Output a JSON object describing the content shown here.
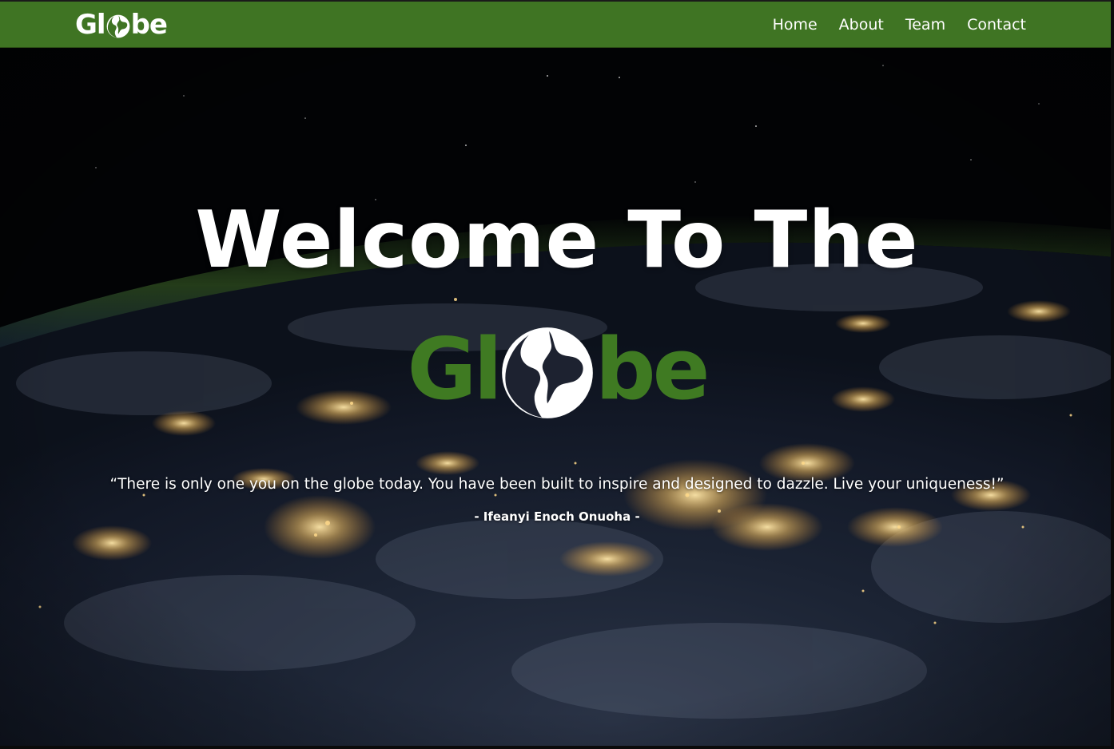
{
  "brand": {
    "prefix": "Gl",
    "suffix": "be",
    "logo_icon": "globe-icon"
  },
  "nav": {
    "items": [
      {
        "label": "Home"
      },
      {
        "label": "About"
      },
      {
        "label": "Team"
      },
      {
        "label": "Contact"
      }
    ]
  },
  "hero": {
    "title": "Welcome To The",
    "logo_prefix": "Gl",
    "logo_suffix": "be",
    "quote": "“There is only one you on the globe today. You have been built to inspire and designed to dazzle. Live your uniqueness!”",
    "author": "- Ifeanyi Enoch Onuoha -"
  },
  "colors": {
    "brand_green": "#3f7423",
    "logo_green": "#3f7a22",
    "text_white": "#ffffff"
  }
}
